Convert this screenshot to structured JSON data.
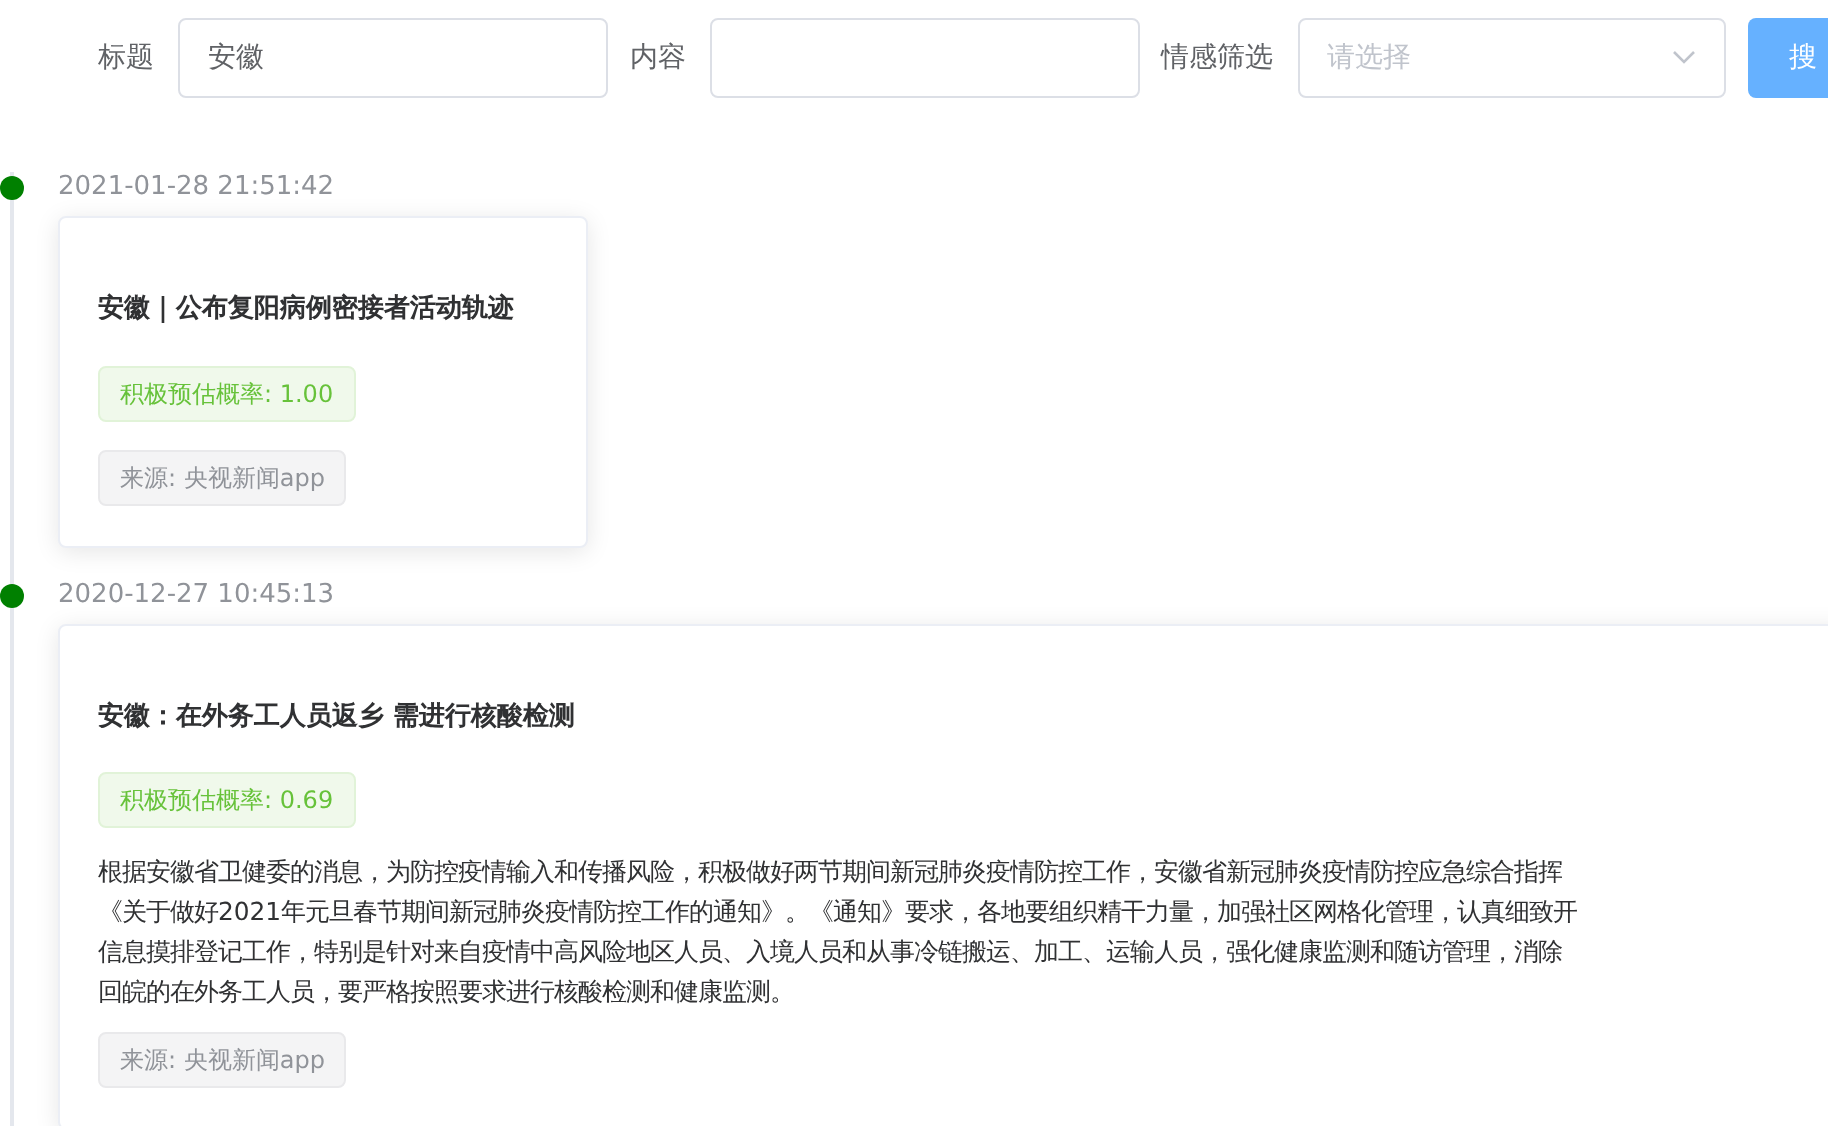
{
  "filters": [
    {
      "kind": "input",
      "label": "标题",
      "value": "安徽"
    },
    {
      "kind": "input",
      "label": "内容"
    },
    {
      "kind": "select",
      "label": "情感筛选",
      "placeholder": "请选择"
    }
  ],
  "search_button": "搜",
  "timeline": [
    {
      "timestamp": "2021-01-28 21:51:42",
      "color": "#008000",
      "title": "安徽｜公布复阳病例密接者活动轨迹",
      "score": "积极预估概率: 1.00",
      "source": "来源: 央视新闻app"
    },
    {
      "timestamp": "2020-12-27 10:45:13",
      "color": "#008000",
      "title": "安徽：在外务工人员返乡 需进行核酸检测",
      "score": "积极预估概率: 0.69",
      "body_lines": [
        "根据安徽省卫健委的消息，为防控疫情输入和传播风险，积极做好两节期间新冠肺炎疫情防控工作，安徽省新冠肺炎疫情防控应急综合指挥",
        "《关于做好2021年元旦春节期间新冠肺炎疫情防控工作的通知》。《通知》要求，各地要组织精干力量，加强社区网格化管理，认真细致开",
        "信息摸排登记工作，特别是针对来自疫情中高风险地区人员、入境人员和从事冷链搬运、加工、运输人员，强化健康监测和随访管理，消除",
        "回皖的在外务工人员，要严格按照要求进行核酸检测和健康监测。"
      ],
      "source": "来源: 央视新闻app"
    }
  ]
}
